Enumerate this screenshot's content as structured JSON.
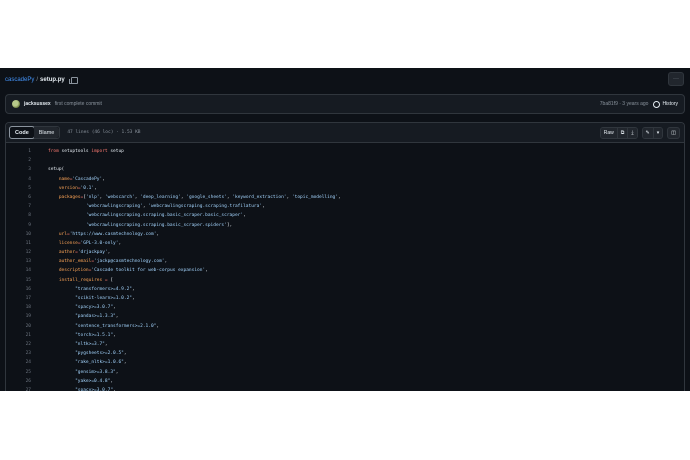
{
  "breadcrumb": {
    "repo": "cascadePy",
    "separator": "/",
    "file": "setup.py"
  },
  "more_label": "···",
  "commit": {
    "author": "jacksussex",
    "message": "first complete commit",
    "meta": "7ba81f9 · 3 years ago",
    "history_label": "History"
  },
  "file_header": {
    "tabs": [
      "Code",
      "Blame"
    ],
    "info": "47 lines (46 loc) · 1.53 KB",
    "raw_label": "Raw",
    "copy_glyph": "⧉",
    "download_glyph": "⤓",
    "edit_glyph": "✎",
    "caret_glyph": "▾",
    "symbols_glyph": "◫"
  },
  "code_lines": [
    {
      "n": "1",
      "parts": [
        {
          "t": "from",
          "c": "kw"
        },
        {
          "t": " setuptools ",
          "c": ""
        },
        {
          "t": "import",
          "c": "kw"
        },
        {
          "t": " setup",
          "c": ""
        }
      ]
    },
    {
      "n": "2",
      "parts": []
    },
    {
      "n": "3",
      "parts": [
        {
          "t": "setup(",
          "c": ""
        }
      ]
    },
    {
      "n": "4",
      "parts": [
        {
          "t": "    ",
          "c": ""
        },
        {
          "t": "name",
          "c": "var"
        },
        {
          "t": "=",
          "c": "kw"
        },
        {
          "t": "'CascadePy'",
          "c": "str"
        },
        {
          "t": ",",
          "c": ""
        }
      ]
    },
    {
      "n": "5",
      "parts": [
        {
          "t": "    ",
          "c": ""
        },
        {
          "t": "version",
          "c": "var"
        },
        {
          "t": "=",
          "c": "kw"
        },
        {
          "t": "'0.1'",
          "c": "str"
        },
        {
          "t": ",",
          "c": ""
        }
      ]
    },
    {
      "n": "6",
      "parts": [
        {
          "t": "    ",
          "c": ""
        },
        {
          "t": "packages",
          "c": "var"
        },
        {
          "t": "=",
          "c": "kw"
        },
        {
          "t": "[",
          "c": ""
        },
        {
          "t": "'nlp'",
          "c": "str"
        },
        {
          "t": ", ",
          "c": ""
        },
        {
          "t": "'webscarch'",
          "c": "str"
        },
        {
          "t": ", ",
          "c": ""
        },
        {
          "t": "'deep_learning'",
          "c": "str"
        },
        {
          "t": ", ",
          "c": ""
        },
        {
          "t": "'google_sheets'",
          "c": "str"
        },
        {
          "t": ", ",
          "c": ""
        },
        {
          "t": "'keyword_extraction'",
          "c": "str"
        },
        {
          "t": ", ",
          "c": ""
        },
        {
          "t": "'topic_modelling'",
          "c": "str"
        },
        {
          "t": ",",
          "c": ""
        }
      ]
    },
    {
      "n": "7",
      "parts": [
        {
          "t": "              ",
          "c": ""
        },
        {
          "t": "'webcrawlingscraping'",
          "c": "str"
        },
        {
          "t": ", ",
          "c": ""
        },
        {
          "t": "'webcrawlingscraping.scraping.trafilatura'",
          "c": "str"
        },
        {
          "t": ",",
          "c": ""
        }
      ]
    },
    {
      "n": "8",
      "parts": [
        {
          "t": "              ",
          "c": ""
        },
        {
          "t": "'webcrawlingscraping.scraping.basic_scraper.basic_scraper'",
          "c": "str"
        },
        {
          "t": ",",
          "c": ""
        }
      ]
    },
    {
      "n": "9",
      "parts": [
        {
          "t": "              ",
          "c": ""
        },
        {
          "t": "'webcrawlingscraping.scraping.basic_scraper.spiders'",
          "c": "str"
        },
        {
          "t": "],",
          "c": ""
        }
      ]
    },
    {
      "n": "10",
      "parts": [
        {
          "t": "    ",
          "c": ""
        },
        {
          "t": "url",
          "c": "var"
        },
        {
          "t": "=",
          "c": "kw"
        },
        {
          "t": "'https://www.casmtechnology.com'",
          "c": "str"
        },
        {
          "t": ",",
          "c": ""
        }
      ]
    },
    {
      "n": "11",
      "parts": [
        {
          "t": "    ",
          "c": ""
        },
        {
          "t": "license",
          "c": "var"
        },
        {
          "t": "=",
          "c": "kw"
        },
        {
          "t": "'GPL-3.0-only'",
          "c": "str"
        },
        {
          "t": ",",
          "c": ""
        }
      ]
    },
    {
      "n": "12",
      "parts": [
        {
          "t": "    ",
          "c": ""
        },
        {
          "t": "author",
          "c": "var"
        },
        {
          "t": "=",
          "c": "kw"
        },
        {
          "t": "'drjackpay'",
          "c": "str"
        },
        {
          "t": ",",
          "c": ""
        }
      ]
    },
    {
      "n": "13",
      "parts": [
        {
          "t": "    ",
          "c": ""
        },
        {
          "t": "author_email",
          "c": "var"
        },
        {
          "t": "=",
          "c": "kw"
        },
        {
          "t": "'jackp@casmtechnology.com'",
          "c": "str"
        },
        {
          "t": ",",
          "c": ""
        }
      ]
    },
    {
      "n": "14",
      "parts": [
        {
          "t": "    ",
          "c": ""
        },
        {
          "t": "description",
          "c": "var"
        },
        {
          "t": "=",
          "c": "kw"
        },
        {
          "t": "'Cascade toolkit for web-corpus expansion'",
          "c": "str"
        },
        {
          "t": ",",
          "c": ""
        }
      ]
    },
    {
      "n": "15",
      "parts": [
        {
          "t": "    ",
          "c": ""
        },
        {
          "t": "install_requires",
          "c": "var"
        },
        {
          "t": " = ",
          "c": "kw"
        },
        {
          "t": "[",
          "c": ""
        }
      ]
    },
    {
      "n": "16",
      "parts": [
        {
          "t": "          ",
          "c": ""
        },
        {
          "t": "\"transformers>=4.9.2\"",
          "c": "str"
        },
        {
          "t": ",",
          "c": ""
        }
      ]
    },
    {
      "n": "17",
      "parts": [
        {
          "t": "          ",
          "c": ""
        },
        {
          "t": "\"scikit-learn>=1.0.2\"",
          "c": "str"
        },
        {
          "t": ",",
          "c": ""
        }
      ]
    },
    {
      "n": "18",
      "parts": [
        {
          "t": "          ",
          "c": ""
        },
        {
          "t": "\"spacy>=3.0.7\"",
          "c": "str"
        },
        {
          "t": ",",
          "c": ""
        }
      ]
    },
    {
      "n": "19",
      "parts": [
        {
          "t": "          ",
          "c": ""
        },
        {
          "t": "\"pandas>=1.3.3\"",
          "c": "str"
        },
        {
          "t": ",",
          "c": ""
        }
      ]
    },
    {
      "n": "20",
      "parts": [
        {
          "t": "          ",
          "c": ""
        },
        {
          "t": "\"sentence_transformers>=2.1.0\"",
          "c": "str"
        },
        {
          "t": ",",
          "c": ""
        }
      ]
    },
    {
      "n": "21",
      "parts": [
        {
          "t": "          ",
          "c": ""
        },
        {
          "t": "\"torch>=1.5.1\"",
          "c": "str"
        },
        {
          "t": ",",
          "c": ""
        }
      ]
    },
    {
      "n": "22",
      "parts": [
        {
          "t": "          ",
          "c": ""
        },
        {
          "t": "\"nltk>=3.7\"",
          "c": "str"
        },
        {
          "t": ",",
          "c": ""
        }
      ]
    },
    {
      "n": "23",
      "parts": [
        {
          "t": "          ",
          "c": ""
        },
        {
          "t": "\"pygsheets>=2.0.5\"",
          "c": "str"
        },
        {
          "t": ",",
          "c": ""
        }
      ]
    },
    {
      "n": "24",
      "parts": [
        {
          "t": "          ",
          "c": ""
        },
        {
          "t": "\"rake_nltk>=1.0.6\"",
          "c": "str"
        },
        {
          "t": ",",
          "c": ""
        }
      ]
    },
    {
      "n": "25",
      "parts": [
        {
          "t": "          ",
          "c": ""
        },
        {
          "t": "\"gensim>=3.8.3\"",
          "c": "str"
        },
        {
          "t": ",",
          "c": ""
        }
      ]
    },
    {
      "n": "26",
      "parts": [
        {
          "t": "          ",
          "c": ""
        },
        {
          "t": "\"yake>=0.4.8\"",
          "c": "str"
        },
        {
          "t": ",",
          "c": ""
        }
      ]
    },
    {
      "n": "27",
      "parts": [
        {
          "t": "          ",
          "c": ""
        },
        {
          "t": "\"spacy>=3.0.7\"",
          "c": "str"
        },
        {
          "t": ",",
          "c": ""
        }
      ]
    }
  ]
}
